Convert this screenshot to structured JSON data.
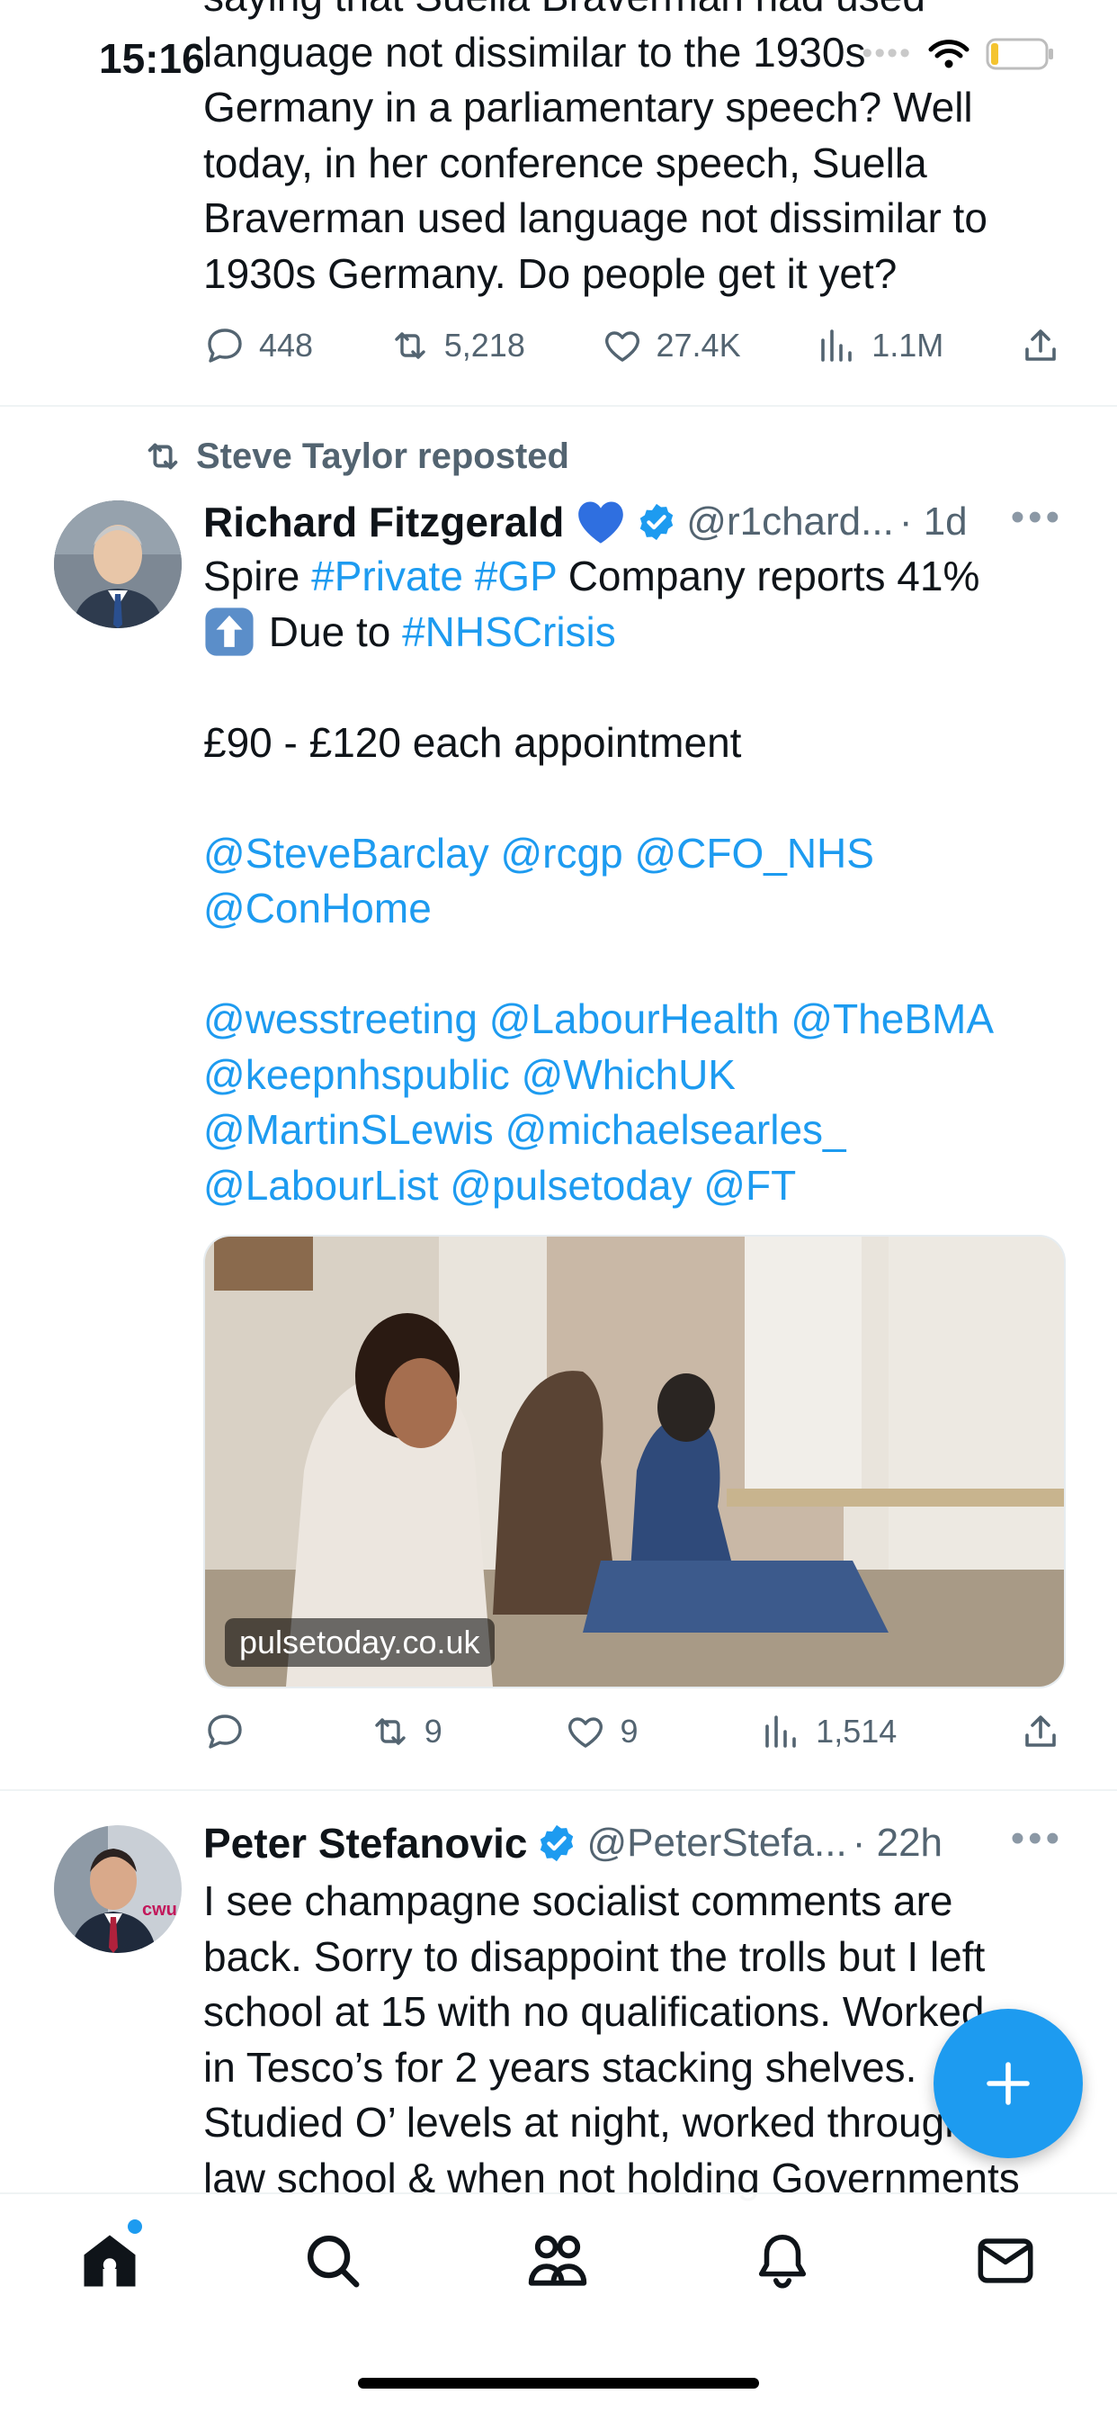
{
  "status_bar": {
    "time": "15:16"
  },
  "tweet1": {
    "partial_line": "saying that Suella Braverman had used",
    "lines": [
      "language not dissimilar to the 1930s",
      "Germany in a parliamentary speech? Well",
      "today, in her conference speech, Suella",
      "Braverman used language not dissimilar to",
      "1930s Germany. Do people get it yet?"
    ],
    "replies": "448",
    "reposts": "5,218",
    "likes": "27.4K",
    "views": "1.1M"
  },
  "tweet2": {
    "repost_label": "Steve Taylor reposted",
    "author_name": "Richard Fitzgerald",
    "handle": "@r1chard...",
    "time": "· 1d",
    "line1": {
      "a": "Spire ",
      "tag1": "#Private",
      "sp": " ",
      "tag2": "#GP",
      "b": " Company  reports 41%"
    },
    "line2": {
      "a": " Due to ",
      "tag": "#NHSCrisis"
    },
    "price_line": "£90 - £120 each appointment",
    "mentions1": "@SteveBarclay @rcgp @CFO_NHS",
    "mentions2": "@ConHome",
    "mentions3": "@wesstreeting @LabourHealth @TheBMA",
    "mentions4": "@keepnhspublic @WhichUK",
    "mentions5": "@MartinSLewis @michaelsearles_",
    "mentions6": "@LabourList @pulsetoday @FT",
    "media_source": "pulsetoday.co.uk",
    "reposts": "9",
    "likes": "9",
    "views": "1,514"
  },
  "tweet3": {
    "author_name": "Peter Stefanovic",
    "handle": "@PeterStefa...",
    "time": "· 22h",
    "lines": [
      "I see champagne socialist comments are",
      "back. Sorry to disappoint the trolls but I left",
      "school at 15 with no qualifications. Worked",
      "in Tesco’s for 2 years stacking shelves.",
      "Studied O’ levels at night, worked through",
      "law school & when not holding Governments"
    ],
    "avatar_badge": "cwu"
  },
  "colors": {
    "accent": "#1d9bf0",
    "muted": "#536471",
    "verified": "#1d9bf0"
  },
  "icons": [
    "reply-icon",
    "repost-icon",
    "like-icon",
    "views-icon",
    "share-icon",
    "verified-badge-icon",
    "more-icon",
    "compose-icon",
    "home-icon",
    "search-icon",
    "communities-icon",
    "notifications-icon",
    "messages-icon"
  ]
}
